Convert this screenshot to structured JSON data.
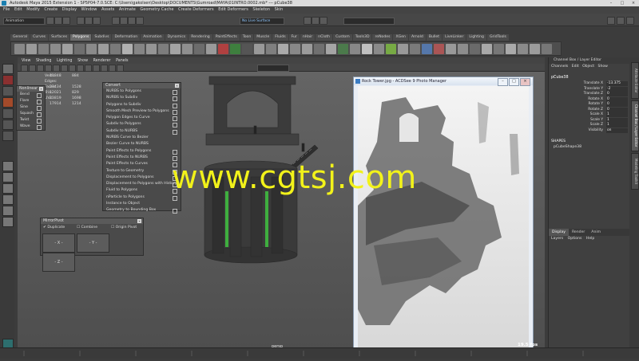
{
  "window": {
    "title": "Autodesk Maya 2015 Extension 1 - SP5P04-7.0.SCE: C:\\Users\\gakolsen\\Desktop\\DOCUMENTS\\Gumroad\\MAYA\\01INTRO.0002.mb* --- pCube38",
    "controls": [
      "–",
      "□",
      "×"
    ]
  },
  "menubar": [
    "File",
    "Edit",
    "Modify",
    "Create",
    "Display",
    "Window",
    "Assets",
    "Animate",
    "Geometry Cache",
    "Create Deformers",
    "Edit Deformers",
    "Skeleton",
    "Skin"
  ],
  "statusline": {
    "mode_dropdown": "Animation",
    "live_surface": "No Live Surface"
  },
  "shelf": {
    "tabs": [
      "General",
      "Curves",
      "Surfaces",
      "Polygons",
      "Subdivs",
      "Deformation",
      "Animation",
      "Dynamics",
      "Rendering",
      "PaintEffects",
      "Toon",
      "Muscle",
      "Fluids",
      "Fur",
      "nHair",
      "nCloth",
      "Custom",
      "Tools3D",
      "reNodes",
      "XGen",
      "Arnold",
      "Bullet",
      "LiveLinker",
      "Lighting",
      "GridTools"
    ],
    "active_tab": "Polygons"
  },
  "viewport": {
    "menu": [
      "View",
      "Shading",
      "Lighting",
      "Show",
      "Renderer",
      "Panels"
    ],
    "hud": [
      {
        "label": "Verts:",
        "a": "11848",
        "b": "884"
      },
      {
        "label": "Edges:",
        "a": "",
        "b": ""
      },
      {
        "label": "Faces:",
        "a": "23434",
        "b": "1528"
      },
      {
        "label": "Tris:",
        "a": "12021",
        "b": "829"
      },
      {
        "label": "UVs:",
        "a": "23819",
        "b": "1698"
      },
      {
        "label": "",
        "a": "17914",
        "b": "1214"
      }
    ],
    "camera_label": "persp",
    "fps": "19.5 fps",
    "watermark": "www.cgtsj.com"
  },
  "nonlinear_panel": {
    "title": "Nonlinear",
    "items": [
      "Bend",
      "Flare",
      "Sine",
      "Squash",
      "Twist",
      "Wave"
    ]
  },
  "convert_panel": {
    "title": "Convert",
    "items": [
      "NURBS to Polygons",
      "NURBS to Subdiv",
      "Polygons to Subdiv",
      "Smooth Mesh Preview to Polygons",
      "Polygon Edges to Curve",
      "Subdiv to Polygons",
      "Subdiv to NURBS",
      "NURBS Curve to Bezier",
      "Bezier Curve to NURBS",
      "Paint Effects to Polygons",
      "Paint Effects to NURBS",
      "Paint Effects to Curves",
      "Texture to Geometry",
      "Displacement to Polygons",
      "Displacement to Polygons with History",
      "Fluid to Polygons",
      "nParticle to Polygons",
      "Instance to Object",
      "Geometry to Bounding Box"
    ]
  },
  "mirror_panel": {
    "title": "MirrorPivot",
    "options": [
      "Duplicate",
      "Combine",
      "Origin Pivot"
    ],
    "buttons": [
      "- X -",
      "- Y -",
      "- Z -"
    ]
  },
  "photo_window": {
    "title": "Rock Tower.jpg - ACDSee 9 Photo Manager",
    "buttons": [
      "–",
      "□",
      "×"
    ]
  },
  "channel_box": {
    "header": "Channel Box / Layer Editor",
    "menu": [
      "Channels",
      "Edit",
      "Object",
      "Show"
    ],
    "object": "pCube38",
    "attributes": [
      {
        "name": "Translate X",
        "value": "-13.375"
      },
      {
        "name": "Translate Y",
        "value": "-2"
      },
      {
        "name": "Translate Z",
        "value": "0"
      },
      {
        "name": "Rotate X",
        "value": "0"
      },
      {
        "name": "Rotate Y",
        "value": "0"
      },
      {
        "name": "Rotate Z",
        "value": "0"
      },
      {
        "name": "Scale X",
        "value": "1"
      },
      {
        "name": "Scale Y",
        "value": "1"
      },
      {
        "name": "Scale Z",
        "value": "1"
      },
      {
        "name": "Visibility",
        "value": "on"
      }
    ],
    "shapes_label": "SHAPES",
    "shape": "pCubeShape38",
    "layer_tabs": [
      "Display",
      "Render",
      "Anim"
    ],
    "layer_menu": [
      "Layers",
      "Options",
      "Help"
    ]
  },
  "side_tabs": [
    "Attribute Editor",
    "Channel Box / Layer Editor",
    "Modeling Toolkit"
  ],
  "colors": {
    "watermark": "#f2f21a",
    "maya_bg": "#3c3c3c",
    "viewport": "#5a5a5a"
  }
}
